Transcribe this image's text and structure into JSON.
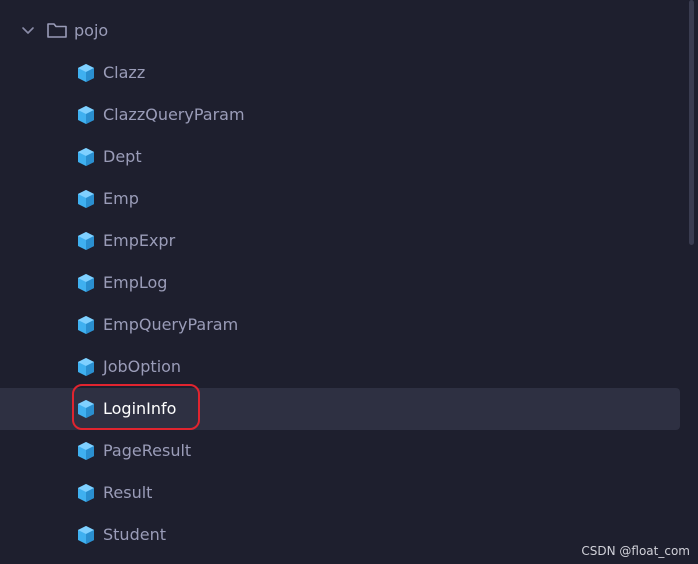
{
  "folder": {
    "label": "pojo",
    "icon": "folder-icon",
    "expanded": true
  },
  "files": [
    {
      "label": "Clazz",
      "icon": "java-class-icon",
      "selected": false
    },
    {
      "label": "ClazzQueryParam",
      "icon": "java-class-icon",
      "selected": false
    },
    {
      "label": "Dept",
      "icon": "java-class-icon",
      "selected": false
    },
    {
      "label": "Emp",
      "icon": "java-class-icon",
      "selected": false
    },
    {
      "label": "EmpExpr",
      "icon": "java-class-icon",
      "selected": false
    },
    {
      "label": "EmpLog",
      "icon": "java-class-icon",
      "selected": false
    },
    {
      "label": "EmpQueryParam",
      "icon": "java-class-icon",
      "selected": false
    },
    {
      "label": "JobOption",
      "icon": "java-class-icon",
      "selected": false
    },
    {
      "label": "LoginInfo",
      "icon": "java-class-icon",
      "selected": true
    },
    {
      "label": "PageResult",
      "icon": "java-class-icon",
      "selected": false
    },
    {
      "label": "Result",
      "icon": "java-class-icon",
      "selected": false
    },
    {
      "label": "Student",
      "icon": "java-class-icon",
      "selected": false
    }
  ],
  "annotation": {
    "color": "#e0242f",
    "target": "LoginInfo"
  },
  "colors": {
    "background": "#1e1f2e",
    "selected_row": "#2e3042",
    "icon_blue": "#3fb0f0",
    "text": "#9a9cb8",
    "selected_text": "#ffffff"
  },
  "watermark": "CSDN @float_com"
}
